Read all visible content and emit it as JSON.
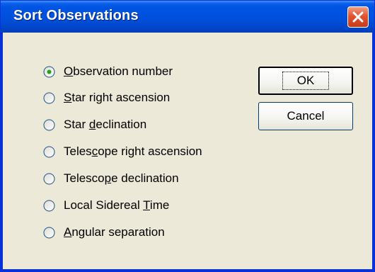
{
  "dialog": {
    "title": "Sort Observations"
  },
  "options": [
    {
      "pre": "",
      "key": "O",
      "post": "bservation number",
      "selected": true
    },
    {
      "pre": "",
      "key": "S",
      "post": "tar right ascension",
      "selected": false
    },
    {
      "pre": "Star ",
      "key": "d",
      "post": "eclination",
      "selected": false
    },
    {
      "pre": "Teles",
      "key": "c",
      "post": "ope right ascension",
      "selected": false
    },
    {
      "pre": "Telesco",
      "key": "p",
      "post": "e declination",
      "selected": false
    },
    {
      "pre": "Local Sidereal ",
      "key": "T",
      "post": "ime",
      "selected": false
    },
    {
      "pre": "",
      "key": "A",
      "post": "ngular separation",
      "selected": false
    }
  ],
  "buttons": {
    "ok_label": "OK",
    "cancel_label": "Cancel"
  },
  "colors": {
    "titlebar": "#0054e3",
    "client": "#ece9d8",
    "close": "#e1542f"
  }
}
